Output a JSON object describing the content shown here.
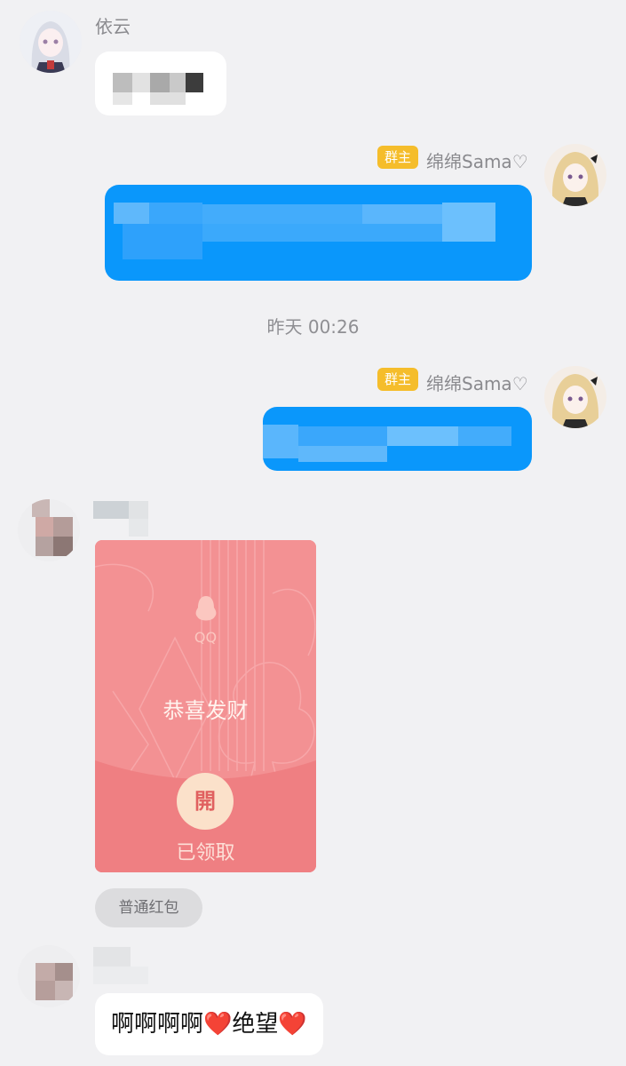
{
  "messages": {
    "m1": {
      "sender": "依云"
    },
    "m2": {
      "badge": "群主",
      "sender": "绵绵Sama♡"
    },
    "timestamp": "昨天 00:26",
    "m3": {
      "badge": "群主",
      "sender": "绵绵Sama♡"
    },
    "m4": {
      "red_packet": {
        "brand": "QQ",
        "greeting": "恭喜发财",
        "open_char": "開",
        "status": "已领取",
        "type_label": "普通红包"
      }
    },
    "m5": {
      "text": "啊啊啊啊❤️绝望❤️"
    }
  },
  "colors": {
    "background": "#f1f1f3",
    "outgoing_bubble": "#0a97fb",
    "badge": "#f5bd2b",
    "red_packet": "#f39193"
  }
}
